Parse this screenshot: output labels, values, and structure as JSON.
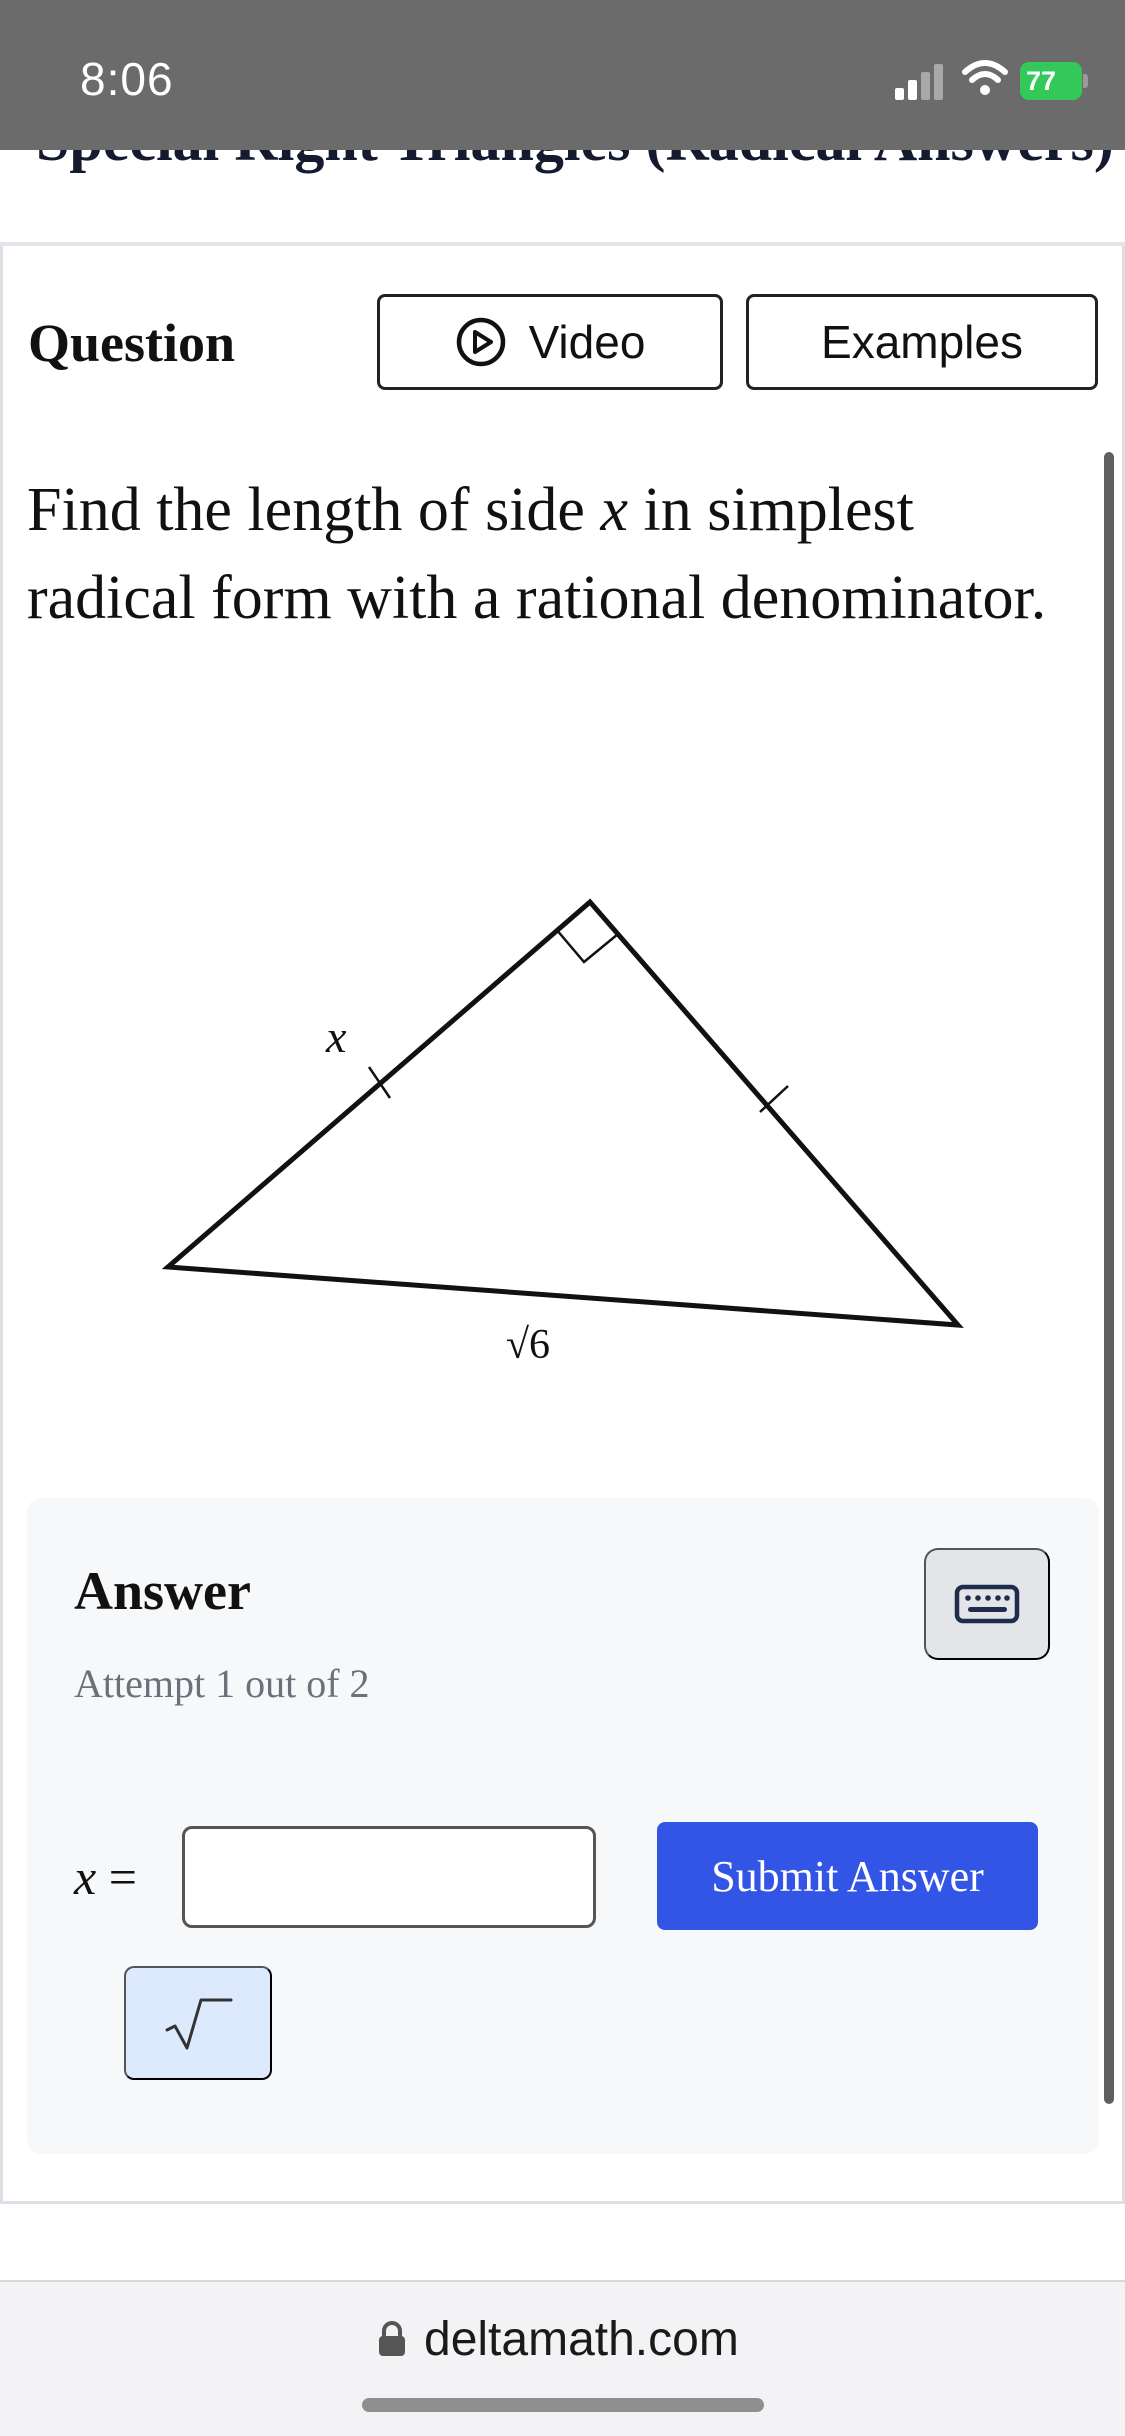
{
  "status_bar": {
    "time": "8:06",
    "battery": "77"
  },
  "page": {
    "title": "Special Right Triangles (Radical Answers)"
  },
  "question": {
    "label": "Question",
    "video_label": "Video",
    "examples_label": "Examples",
    "prompt_before": "Find the length of side ",
    "prompt_var": "x",
    "prompt_after": " in simplest radical form with a rational denominator."
  },
  "figure": {
    "leg_label": "x",
    "hypotenuse_label": "√6"
  },
  "answer": {
    "title": "Answer",
    "attempt": "Attempt 1 out of 2",
    "var": "x",
    "equals": " =",
    "input_value": "",
    "submit_label": "Submit Answer"
  },
  "browser": {
    "url": "deltamath.com"
  },
  "colors": {
    "status_bar": "#6b6b6b",
    "battery": "#34c759",
    "submit": "#3355e6",
    "sqrt_button": "#dde9fc",
    "answer_panel": "#f7f8fa"
  },
  "icons": {
    "video": "play-circle-icon",
    "keyboard": "keyboard-icon",
    "sqrt": "square-root-icon",
    "lock": "lock-icon"
  }
}
